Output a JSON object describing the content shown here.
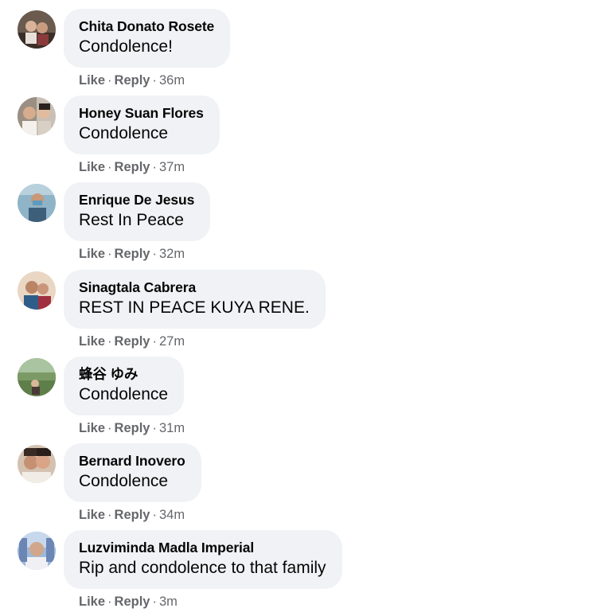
{
  "comments": [
    {
      "name": "Chita Donato Rosete",
      "text": "Condolence!",
      "like": "Like",
      "reply": "Reply",
      "time": "36m"
    },
    {
      "name": "Honey Suan Flores",
      "text": "Condolence",
      "like": "Like",
      "reply": "Reply",
      "time": "37m"
    },
    {
      "name": "Enrique De Jesus",
      "text": "Rest In Peace",
      "like": "Like",
      "reply": "Reply",
      "time": "32m"
    },
    {
      "name": "Sinagtala Cabrera",
      "text": "REST IN PEACE KUYA RENE.",
      "like": "Like",
      "reply": "Reply",
      "time": "27m"
    },
    {
      "name": "蜂谷 ゆみ",
      "text": "Condolence",
      "like": "Like",
      "reply": "Reply",
      "time": "31m"
    },
    {
      "name": "Bernard Inovero",
      "text": "Condolence",
      "like": "Like",
      "reply": "Reply",
      "time": "34m"
    },
    {
      "name": "Luzviminda Madla Imperial",
      "text": "Rip and condolence to that family",
      "like": "Like",
      "reply": "Reply",
      "time": "3m"
    }
  ],
  "colors": {
    "bubble": "#f0f2f5",
    "text": "#050505",
    "meta": "#65676b"
  },
  "icons": [
    "avatar-photo"
  ]
}
